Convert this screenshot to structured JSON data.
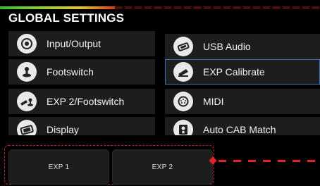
{
  "header": {
    "title": "GLOBAL SETTINGS",
    "meter_level": 0.36
  },
  "menu": {
    "items": [
      {
        "label": "Input/Output",
        "icon": "input-output-icon"
      },
      {
        "label": "USB Audio",
        "icon": "usb-audio-icon"
      },
      {
        "label": "Footswitch",
        "icon": "footswitch-icon"
      },
      {
        "label": "EXP Calibrate",
        "icon": "exp-pedal-icon",
        "selected": true
      },
      {
        "label": "EXP 2/Footswitch",
        "icon": "exp2-footswitch-icon"
      },
      {
        "label": "MIDI",
        "icon": "midi-icon"
      },
      {
        "label": "Display",
        "icon": "display-icon"
      },
      {
        "label": "Auto CAB Match",
        "icon": "cab-speaker-icon"
      }
    ]
  },
  "footer": {
    "exp1_label": "EXP 1",
    "exp2_label": "EXP 2"
  },
  "colors": {
    "accent_red": "#e3232d",
    "selection_blue": "#3a6fb8",
    "tile_bg": "#1d1d1d"
  }
}
